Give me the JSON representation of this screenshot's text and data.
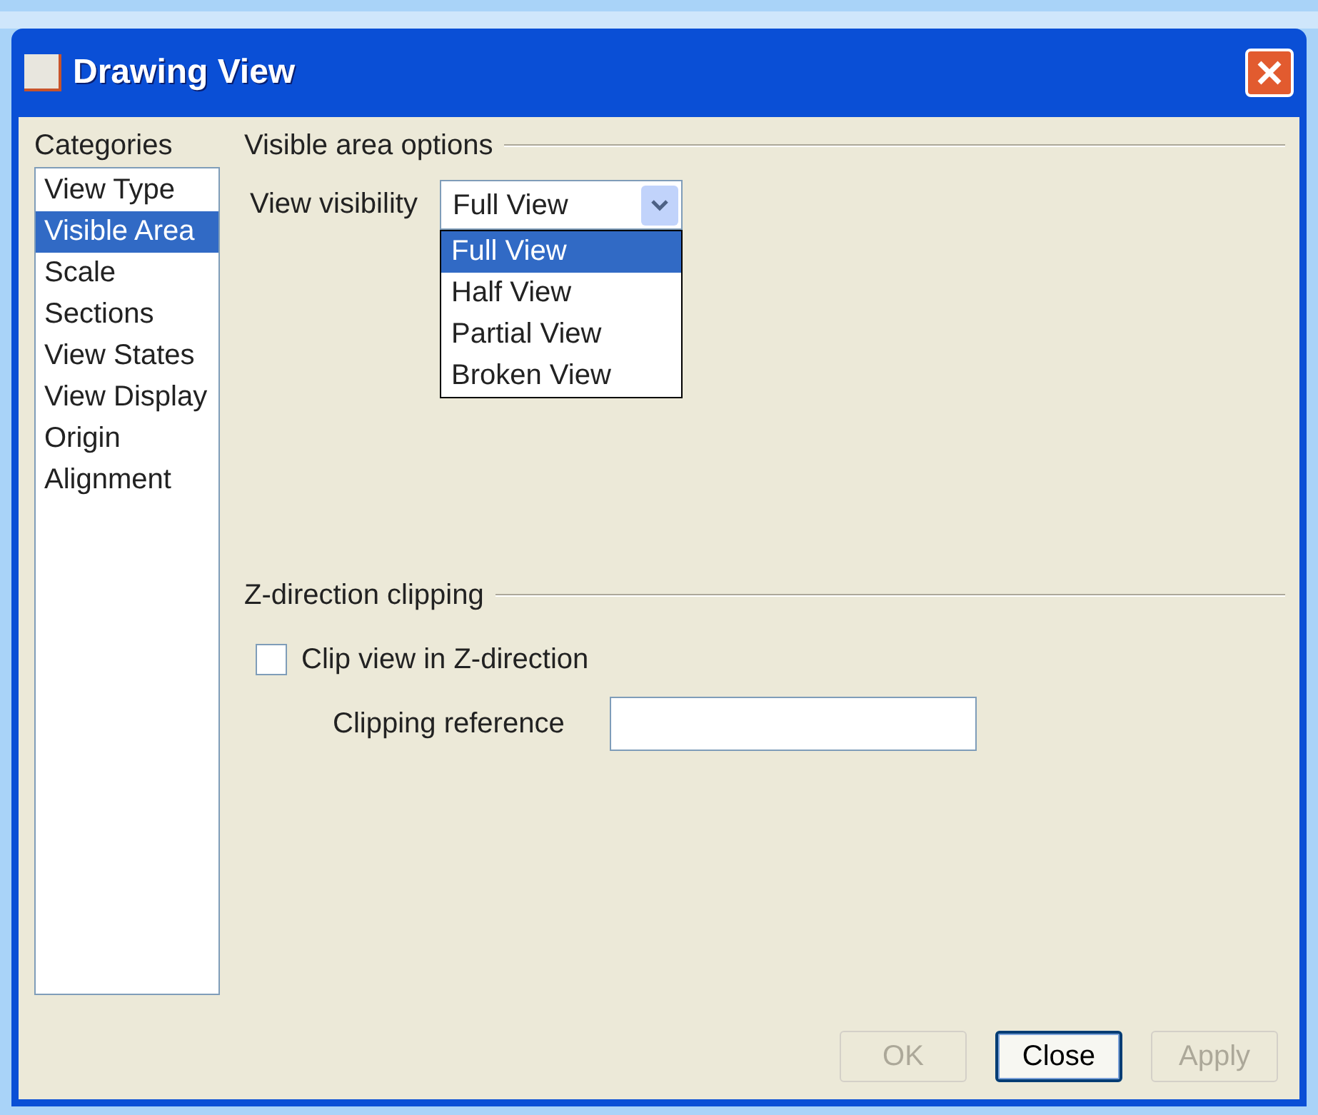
{
  "window": {
    "title": "Drawing View"
  },
  "categories": {
    "label": "Categories",
    "items": [
      {
        "label": "View Type",
        "selected": false
      },
      {
        "label": "Visible Area",
        "selected": true
      },
      {
        "label": "Scale",
        "selected": false
      },
      {
        "label": "Sections",
        "selected": false
      },
      {
        "label": "View States",
        "selected": false
      },
      {
        "label": "View Display",
        "selected": false
      },
      {
        "label": "Origin",
        "selected": false
      },
      {
        "label": "Alignment",
        "selected": false
      }
    ]
  },
  "visible_area": {
    "heading": "Visible area options",
    "label": "View visibility",
    "value": "Full View",
    "expanded": true,
    "options": [
      {
        "label": "Full View",
        "selected": true
      },
      {
        "label": "Half View",
        "selected": false
      },
      {
        "label": "Partial View",
        "selected": false
      },
      {
        "label": "Broken View",
        "selected": false
      }
    ]
  },
  "z_clipping": {
    "heading": "Z-direction clipping",
    "checkbox": {
      "label": "Clip view in Z-direction",
      "checked": false
    },
    "reference_label": "Clipping reference"
  },
  "buttons": [
    {
      "label": "OK",
      "disabled": true,
      "default": false
    },
    {
      "label": "Close",
      "disabled": false,
      "default": true
    },
    {
      "label": "Apply",
      "disabled": true,
      "default": false
    }
  ]
}
